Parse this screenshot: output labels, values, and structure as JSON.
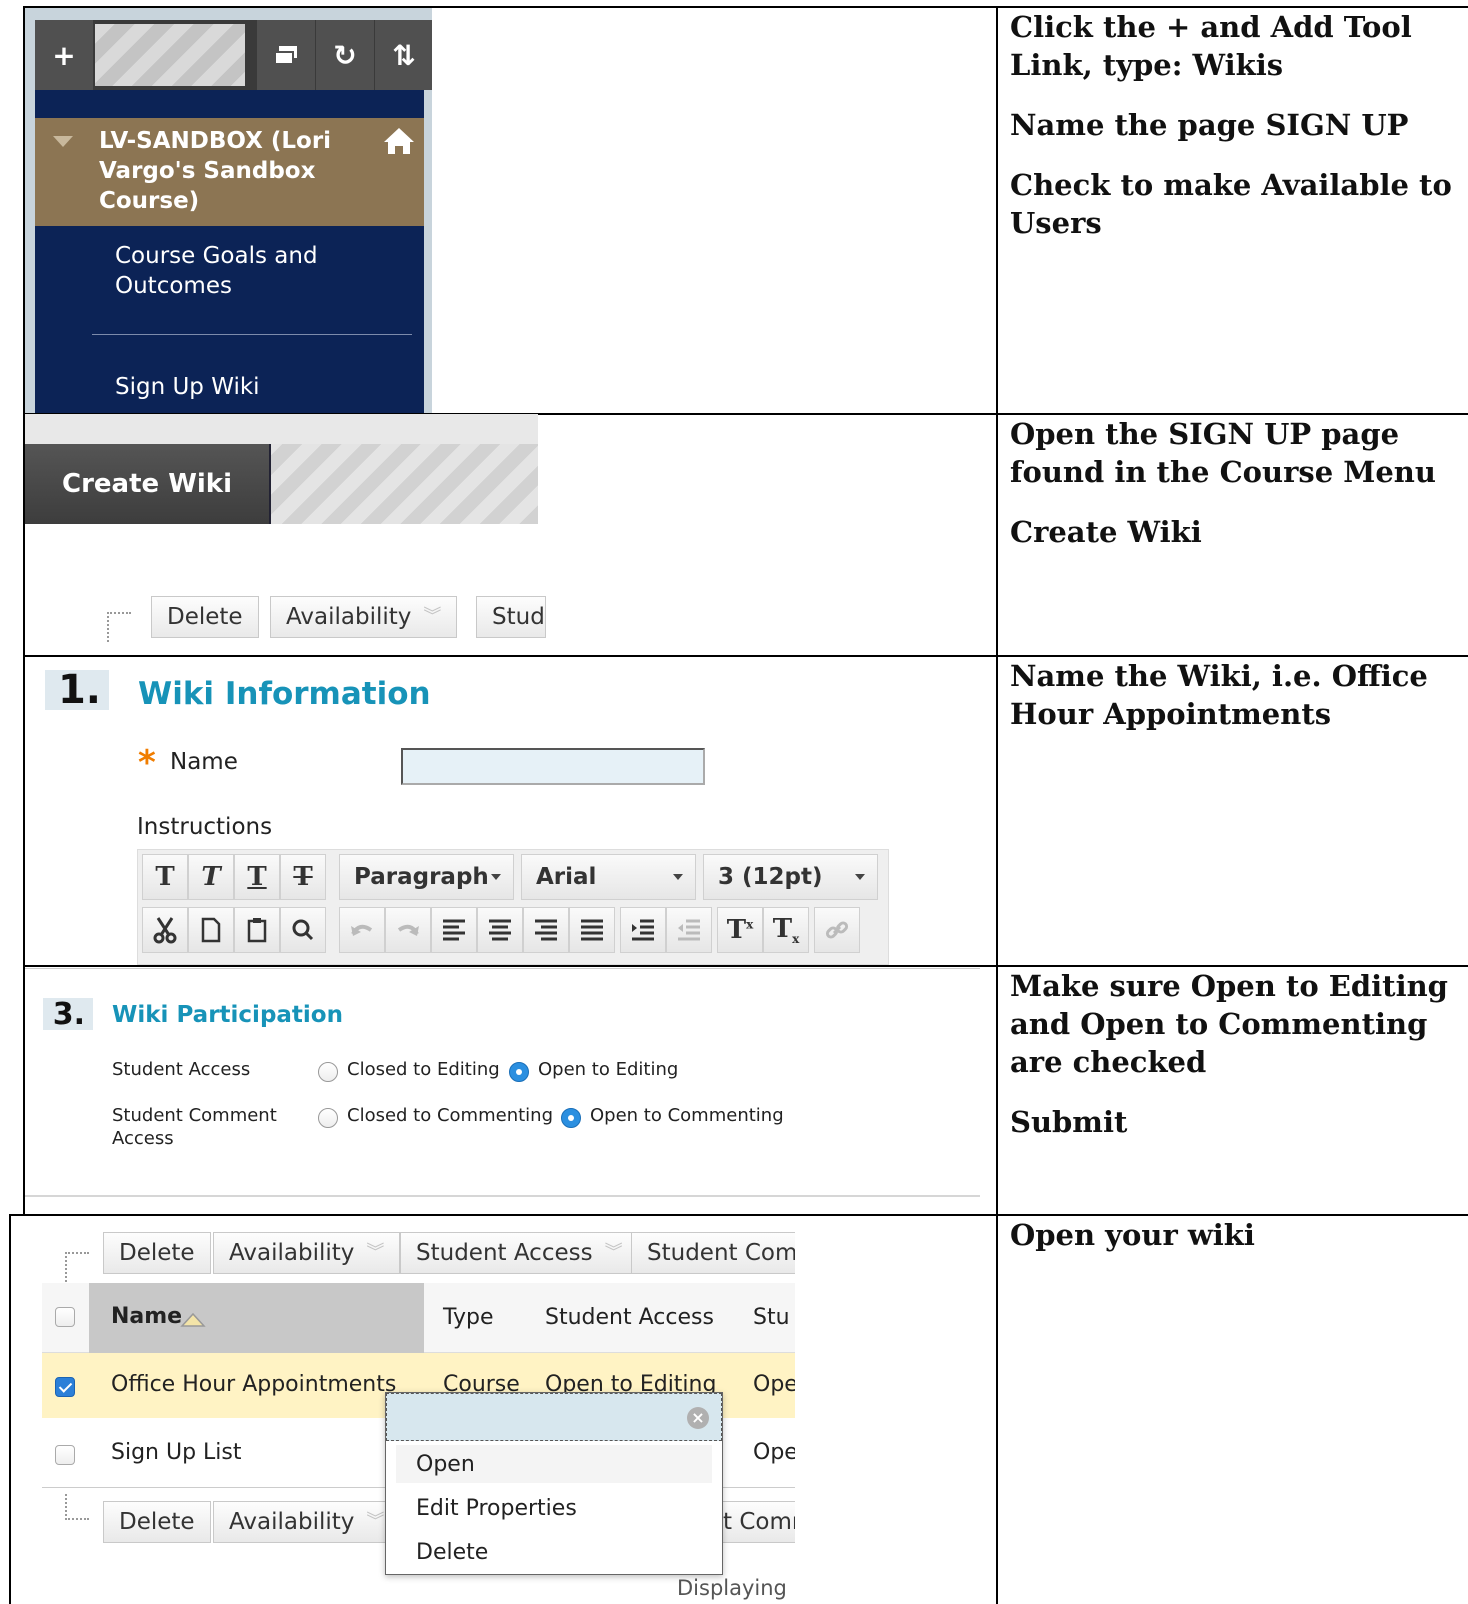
{
  "instructions": {
    "row1": [
      "Click the + and Add Tool Link, type: Wikis",
      "Name the page SIGN UP",
      "Check to make Available to Users"
    ],
    "row2": [
      "Open the SIGN UP page found in the Course Menu",
      "Create Wiki"
    ],
    "row3": [
      "Name the Wiki, i.e. Office Hour Appointments"
    ],
    "row4": [
      "Make sure Open to Editing and Open to Commenting are checked",
      "Submit"
    ],
    "row5": [
      "Open your wiki"
    ]
  },
  "course_menu": {
    "toolbar": {
      "add": "+",
      "refresh": "↻",
      "sort": "⇅"
    },
    "course_title": "LV-SANDBOX (Lori Vargo's Sandbox Course)",
    "items": [
      "Course Goals and Outcomes",
      "Sign Up Wiki"
    ]
  },
  "create_wiki": {
    "button": "Create Wiki",
    "actions": [
      "Delete",
      "Availability",
      "Stud"
    ]
  },
  "wiki_info": {
    "step": "1.",
    "title": "Wiki Information",
    "required_mark": "*",
    "name_label": "Name",
    "name_value": "",
    "instructions_label": "Instructions",
    "editor": {
      "format_buttons": [
        "T",
        "T",
        "T",
        "T"
      ],
      "paragraph": "Paragraph",
      "font": "Arial",
      "size": "3 (12pt)"
    }
  },
  "participation": {
    "step": "3.",
    "title": "Wiki Participation",
    "student_access_label": "Student Access",
    "closed_editing": "Closed to Editing",
    "open_editing": "Open to Editing",
    "comment_label_1": "Student Comment",
    "comment_label_2": "Access",
    "closed_commenting": "Closed to Commenting",
    "open_commenting": "Open to Commenting",
    "editing_selected": "open",
    "commenting_selected": "open"
  },
  "wiki_list": {
    "actions_top": [
      "Delete",
      "Availability",
      "Student Access",
      "Student Comm"
    ],
    "actions_bottom": [
      "Delete",
      "Availability",
      "t Comm"
    ],
    "headers": {
      "name": "Name",
      "type": "Type",
      "student_access": "Student Access",
      "stu": "Stu"
    },
    "rows": [
      {
        "name": "Office Hour Appointments",
        "type": "Course",
        "access": "Open to Editing",
        "comment": "Ope",
        "checked": true
      },
      {
        "name": "Sign Up List",
        "type": "",
        "access": "",
        "comment": "Ope",
        "checked": false
      }
    ],
    "context_menu": [
      "Open",
      "Edit Properties",
      "Delete"
    ],
    "footer": "Displaying"
  },
  "colors": {
    "navy": "#0c2356",
    "course_brown": "#8c7553",
    "heading_blue": "#1793b8",
    "selected_row": "#fff3c4",
    "radio_blue": "#2b8fe0"
  }
}
